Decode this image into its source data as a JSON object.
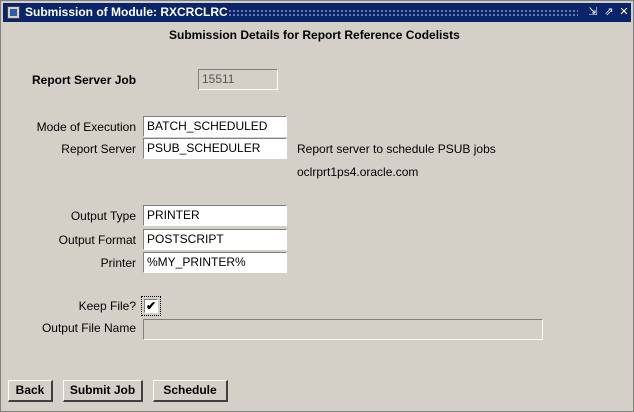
{
  "window": {
    "title": "Submission of Module: RXCRCLRC",
    "controls": {
      "minimize": "⇲",
      "maximize": "⇗",
      "close": "✕"
    }
  },
  "form": {
    "heading": "Submission Details for Report Reference Codelists",
    "report_server_job": {
      "label": "Report Server Job",
      "value": "15511"
    },
    "mode_of_execution": {
      "label": "Mode of Execution",
      "value": "BATCH_SCHEDULED"
    },
    "report_server": {
      "label": "Report Server",
      "value": "PSUB_SCHEDULER",
      "description": "Report server to schedule PSUB jobs",
      "host": "oclrprt1ps4.oracle.com"
    },
    "output_type": {
      "label": "Output Type",
      "value": "PRINTER"
    },
    "output_format": {
      "label": "Output Format",
      "value": "POSTSCRIPT"
    },
    "printer": {
      "label": "Printer",
      "value": "%MY_PRINTER%"
    },
    "keep_file": {
      "label": "Keep File?",
      "checked": true,
      "mark": "✔"
    },
    "output_file_name": {
      "label": "Output File Name",
      "value": ""
    }
  },
  "buttons": {
    "back": "Back",
    "submit_job": "Submit Job",
    "schedule": "Schedule"
  },
  "colors": {
    "titlebar": "#0a246a",
    "panel": "#d4d0c8"
  }
}
